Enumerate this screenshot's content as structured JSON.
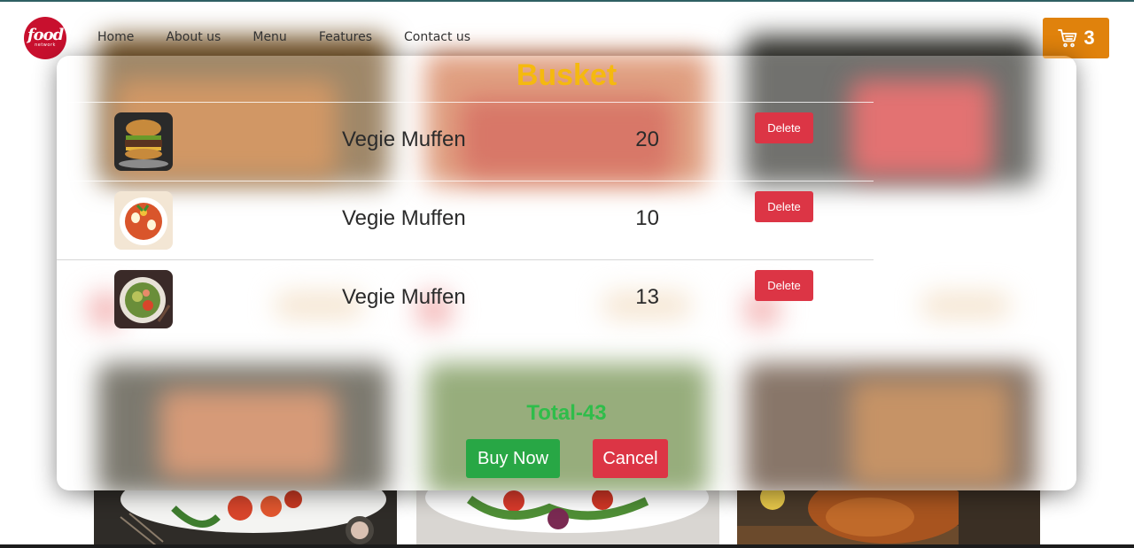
{
  "brand": {
    "logo_main": "food",
    "logo_sub": "network"
  },
  "nav": {
    "links": [
      "Home",
      "About us",
      "Menu",
      "Features",
      "Contact us"
    ]
  },
  "cart": {
    "count": "3",
    "icon": "cart-icon"
  },
  "basket": {
    "title": "Busket",
    "items": [
      {
        "name": "Vegie Muffen",
        "qty": "20",
        "delete_label": "Delete",
        "thumb": "burger"
      },
      {
        "name": "Vegie Muffen",
        "qty": "10",
        "delete_label": "Delete",
        "thumb": "rice-plate"
      },
      {
        "name": "Vegie Muffen",
        "qty": "13",
        "delete_label": "Delete",
        "thumb": "salad-bowl"
      }
    ],
    "total": "Total-43",
    "buy_label": "Buy Now",
    "cancel_label": "Cancel"
  },
  "colors": {
    "accent": "#f5b90f",
    "cart": "#e0820c",
    "danger": "#dc3545",
    "success": "#28a745",
    "logo": "#c8102e"
  }
}
